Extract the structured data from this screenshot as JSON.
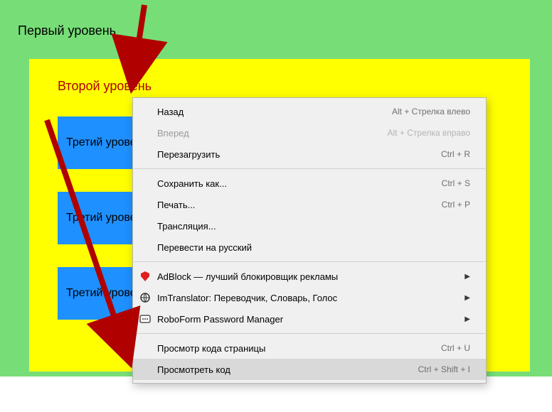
{
  "colors": {
    "outer_bg": "#77dd77",
    "level2_bg": "#ffff00",
    "level3_bg": "#1e90ff",
    "level2_text": "#b00000",
    "arrow": "#b00000"
  },
  "page": {
    "level1_label": "Первый уровень",
    "level2_label": "Второй уровень",
    "level3_label": "Третий уровень"
  },
  "context_menu": {
    "groups": [
      {
        "items": [
          {
            "label": "Назад",
            "shortcut": "Alt + Стрелка влево",
            "enabled": true
          },
          {
            "label": "Вперед",
            "shortcut": "Alt + Стрелка вправо",
            "enabled": false
          },
          {
            "label": "Перезагрузить",
            "shortcut": "Ctrl + R",
            "enabled": true
          }
        ]
      },
      {
        "items": [
          {
            "label": "Сохранить как...",
            "shortcut": "Ctrl + S",
            "enabled": true
          },
          {
            "label": "Печать...",
            "shortcut": "Ctrl + P",
            "enabled": true
          },
          {
            "label": "Трансляция...",
            "shortcut": "",
            "enabled": true
          },
          {
            "label": "Перевести на русский",
            "shortcut": "",
            "enabled": true
          }
        ]
      },
      {
        "items": [
          {
            "label": "AdBlock — лучший блокировщик рекламы",
            "submenu": true,
            "enabled": true,
            "icon": "adblock-icon"
          },
          {
            "label": "ImTranslator: Переводчик, Словарь, Голос",
            "submenu": true,
            "enabled": true,
            "icon": "imtranslator-icon"
          },
          {
            "label": "RoboForm Password Manager",
            "submenu": true,
            "enabled": true,
            "icon": "roboform-icon"
          }
        ]
      },
      {
        "items": [
          {
            "label": "Просмотр кода страницы",
            "shortcut": "Ctrl + U",
            "enabled": true
          },
          {
            "label": "Просмотреть код",
            "shortcut": "Ctrl + Shift + I",
            "enabled": true,
            "highlighted": true
          }
        ]
      }
    ]
  }
}
